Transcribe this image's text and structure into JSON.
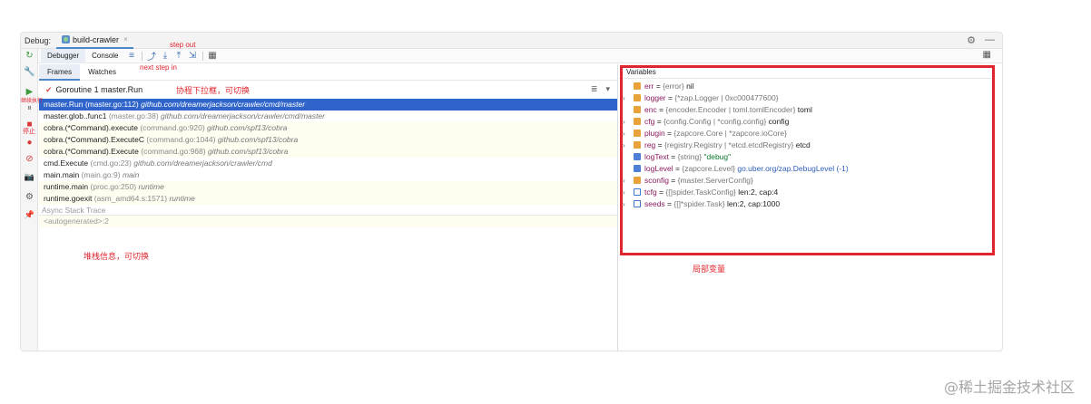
{
  "debug_header": {
    "label": "Debug:",
    "config_name": "build-crawler",
    "close": "×",
    "settings_icon": "⚙",
    "minimize_icon": "—"
  },
  "toolbar": {
    "tabs": [
      "Debugger",
      "Console"
    ],
    "icons": [
      "≡",
      "⤴",
      "⤓",
      "⤒",
      "⇲",
      "▦"
    ],
    "layout_icon": "▦"
  },
  "left_strip": {
    "icons": [
      {
        "glyph": "↻",
        "name": "rerun-icon"
      },
      {
        "glyph": "🔧",
        "name": "wrench-icon"
      },
      {
        "glyph": "▶",
        "name": "resume-icon"
      },
      {
        "glyph": "⏸",
        "name": "pause-icon"
      },
      {
        "glyph": "■",
        "name": "stop-icon"
      },
      {
        "glyph": "●",
        "name": "breakpoints-icon"
      },
      {
        "glyph": "⊘",
        "name": "mute-breakpoints-icon"
      },
      {
        "glyph": "📷",
        "name": "snapshot-icon"
      },
      {
        "glyph": "⚙",
        "name": "settings-icon"
      },
      {
        "glyph": "📌",
        "name": "pin-icon"
      }
    ]
  },
  "frames_tabs": [
    "Frames",
    "Watches"
  ],
  "thread": {
    "label": "Goroutine 1 master.Run",
    "filter_icon": "≣",
    "dropdown_icon": "▾"
  },
  "frames": [
    {
      "fn": "master.Run",
      "loc": "(master.go:112)",
      "pkg": "github.com/dreamerjackson/crawler/cmd/master",
      "selected": true
    },
    {
      "fn": "master.glob..func1",
      "loc": "(master.go:38)",
      "pkg": "github.com/dreamerjackson/crawler/cmd/master",
      "selected": false
    },
    {
      "fn": "cobra.(*Command).execute",
      "loc": "(command.go:920)",
      "pkg": "github.com/spf13/cobra",
      "selected": false
    },
    {
      "fn": "cobra.(*Command).ExecuteC",
      "loc": "(command.go:1044)",
      "pkg": "github.com/spf13/cobra",
      "selected": false
    },
    {
      "fn": "cobra.(*Command).Execute",
      "loc": "(command.go:968)",
      "pkg": "github.com/spf13/cobra",
      "selected": false
    },
    {
      "fn": "cmd.Execute",
      "loc": "(cmd.go:23)",
      "pkg": "github.com/dreamerjackson/crawler/cmd",
      "selected": false
    },
    {
      "fn": "main.main",
      "loc": "(main.go:9)",
      "pkg": "main",
      "selected": false
    },
    {
      "fn": "runtime.main",
      "loc": "(proc.go:250)",
      "pkg": "runtime",
      "selected": false
    },
    {
      "fn": "runtime.goexit",
      "loc": "(asm_amd64.s:1571)",
      "pkg": "runtime",
      "selected": false
    }
  ],
  "async": {
    "header": "Async Stack Trace",
    "autogenerated": "<autogenerated>:2"
  },
  "variables": {
    "header": "Variables",
    "items": [
      {
        "expand": false,
        "icon": "field",
        "name": "err",
        "type": "{error}",
        "value": "nil",
        "style": "plain"
      },
      {
        "expand": true,
        "icon": "field",
        "name": "logger",
        "type": "{*zap.Logger | 0xc000477600}",
        "value": "",
        "style": "plain"
      },
      {
        "expand": false,
        "icon": "field",
        "name": "enc",
        "type": "{encoder.Encoder | toml.tomlEncoder}",
        "value": "toml",
        "style": "plain"
      },
      {
        "expand": true,
        "icon": "field",
        "name": "cfg",
        "type": "{config.Config | *config.config}",
        "value": "config",
        "style": "plain"
      },
      {
        "expand": true,
        "icon": "field",
        "name": "plugin",
        "type": "{zapcore.Core | *zapcore.ioCore}",
        "value": "",
        "style": "plain"
      },
      {
        "expand": true,
        "icon": "field",
        "name": "reg",
        "type": "{registry.Registry | *etcd.etcdRegistry}",
        "value": "etcd",
        "style": "plain"
      },
      {
        "expand": false,
        "icon": "string",
        "name": "logText",
        "type": "{string}",
        "value": "\"debug\"",
        "style": "string"
      },
      {
        "expand": false,
        "icon": "string",
        "name": "logLevel",
        "type": "{zapcore.Level}",
        "value": "go.uber.org/zap.DebugLevel (-1)",
        "style": "link"
      },
      {
        "expand": true,
        "icon": "field",
        "name": "sconfig",
        "type": "{master.ServerConfig}",
        "value": "",
        "style": "plain"
      },
      {
        "expand": true,
        "icon": "list",
        "name": "tcfg",
        "type": "{[]spider.TaskConfig}",
        "value": "len:2, cap:4",
        "style": "plain"
      },
      {
        "expand": true,
        "icon": "list",
        "name": "seeds",
        "type": "{[]*spider.Task}",
        "value": "len:2, cap:1000",
        "style": "plain"
      }
    ]
  },
  "annotations": {
    "step_out": "step out",
    "next_step_in": "next  step in",
    "continue": "继续执行",
    "stop": "停止",
    "thread_pull": "协程下拉框，可切换",
    "stack_info": "堆栈信息，可切换",
    "locals": "局部变量"
  },
  "watermark": "@稀土掘金技术社区"
}
